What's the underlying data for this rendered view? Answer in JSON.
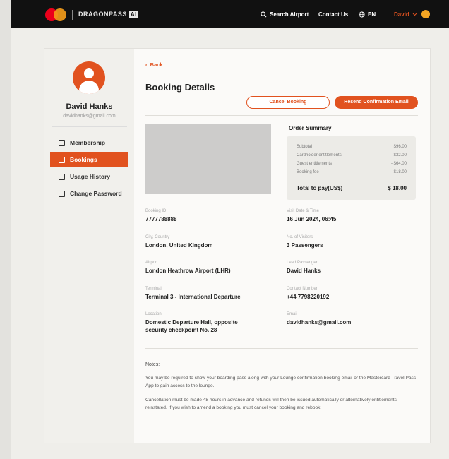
{
  "header": {
    "brand": "DRAGONPASS",
    "brand_badge": "AI",
    "search_label": "Search Airport",
    "contact_label": "Contact Us",
    "language": "EN",
    "user_label": "David"
  },
  "profile": {
    "name": "David Hanks",
    "email": "davidhanks@gmail.com"
  },
  "sidebar": {
    "items": [
      {
        "label": "Membership",
        "icon": "membership-card-icon"
      },
      {
        "label": "Bookings",
        "icon": "calendar-icon",
        "active": true
      },
      {
        "label": "Usage History",
        "icon": "history-icon"
      },
      {
        "label": "Change Password",
        "icon": "lock-icon"
      }
    ]
  },
  "main": {
    "back_label": "Back",
    "title": "Booking Details",
    "cancel_button": "Cancel Booking",
    "resend_button": "Resend Confirmation Email"
  },
  "order_summary": {
    "title": "Order Summary",
    "rows": [
      {
        "label": "Subtotal",
        "value": "$96.00"
      },
      {
        "label": "Cardholder entitlements",
        "value": "- $32.00"
      },
      {
        "label": "Guest entitlements",
        "value": "- $64.00"
      },
      {
        "label": "Booking fee",
        "value": "$18.00"
      }
    ],
    "total_label": "Total to pay(US$)",
    "total_value": "$ 18.00"
  },
  "details": {
    "booking_id": {
      "label": "Booking ID",
      "value": "7777788888"
    },
    "visit": {
      "label": "Visit Date & Time",
      "value": "16 Jun 2024, 06:45"
    },
    "city": {
      "label": "City, Country",
      "value": "London, United Kingdom"
    },
    "visitors": {
      "label": "No. of Visitors",
      "value": "3 Passengers"
    },
    "airport": {
      "label": "Airport",
      "value": "London Heathrow Airport (LHR)"
    },
    "lead": {
      "label": "Lead Passenger",
      "value": "David Hanks"
    },
    "terminal": {
      "label": "Terminal",
      "value": "Terminal 3 - International Departure"
    },
    "contact": {
      "label": "Contact Number",
      "value": "+44 7798220192"
    },
    "location": {
      "label": "Location",
      "value": "Domestic Departure Hall, opposite security checkpoint No. 28"
    },
    "email": {
      "label": "Email",
      "value": "davidhanks@gmail.com"
    }
  },
  "notes": {
    "label": "Notes:",
    "p1": "You may be required to show your boarding pass along with your Lounge confirmation booking email or the Mastercard Travel Pass App to gain access to the lounge.",
    "p2": "Cancellation must be made 48 hours in advance and refunds will then be issued automatically or alternatively entitlements reinstated. If you wish to amend a booking you must cancel your booking and rebook."
  },
  "colors": {
    "accent": "#e1521f",
    "topbar": "#111111"
  }
}
